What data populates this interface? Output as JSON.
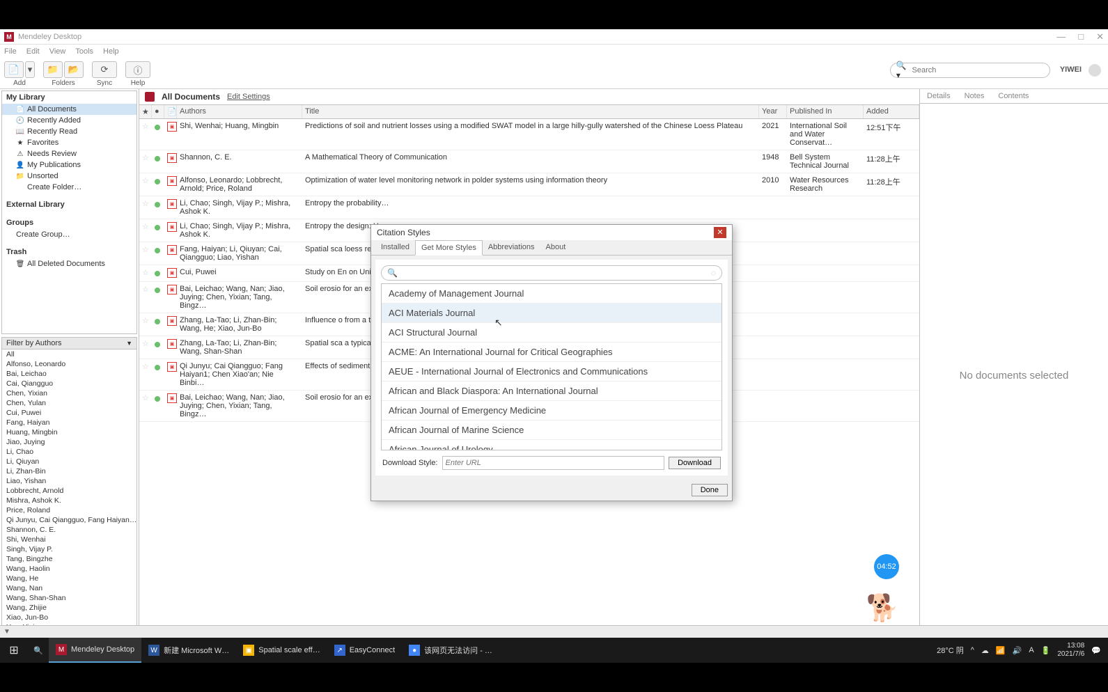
{
  "window": {
    "title": "Mendeley Desktop"
  },
  "menubar": [
    "File",
    "Edit",
    "View",
    "Tools",
    "Help"
  ],
  "toolbar": {
    "add": "Add",
    "folders": "Folders",
    "sync": "Sync",
    "help": "Help",
    "search_placeholder": "Search",
    "user": "YIWEI"
  },
  "library": {
    "my_library": "My Library",
    "items": [
      {
        "label": "All Documents",
        "sel": true,
        "ico": "📄"
      },
      {
        "label": "Recently Added",
        "ico": "🕘"
      },
      {
        "label": "Recently Read",
        "ico": "📖"
      },
      {
        "label": "Favorites",
        "ico": "★"
      },
      {
        "label": "Needs Review",
        "ico": "⚠"
      },
      {
        "label": "My Publications",
        "ico": "👤"
      },
      {
        "label": "Unsorted",
        "ico": "📁"
      },
      {
        "label": "Create Folder…",
        "ico": ""
      }
    ],
    "external": "External Library",
    "groups": "Groups",
    "create_group": "Create Group…",
    "trash": "Trash",
    "all_deleted": "All Deleted Documents"
  },
  "filter": {
    "title": "Filter by Authors",
    "items": [
      "All",
      "Alfonso, Leonardo",
      "Bai, Leichao",
      "Cai, Qiangguo",
      "Chen, Yixian",
      "Chen, Yulan",
      "Cui, Puwei",
      "Fang, Haiyan",
      "Huang, Mingbin",
      "Jiao, Juying",
      "Li, Chao",
      "Li, Qiuyan",
      "Li, Zhan-Bin",
      "Liao, Yishan",
      "Lobbrecht, Arnold",
      "Mishra, Ashok K.",
      "Price, Roland",
      "Qi Junyu, Cai Qiangguo, Fang Haiyan…",
      "Shannon, C. E.",
      "Shi, Wenhai",
      "Singh, Vijay P.",
      "Tang, Bingzhe",
      "Wang, Haolin",
      "Wang, He",
      "Wang, Nan",
      "Wang, Shan-Shan",
      "Wang, Zhijie",
      "Xiao, Jun-Bo",
      "Yan, Yiqin"
    ]
  },
  "doc_header": {
    "title": "All Documents",
    "edit": "Edit Settings"
  },
  "table": {
    "headers": {
      "authors": "Authors",
      "title": "Title",
      "year": "Year",
      "pub": "Published In",
      "added": "Added"
    },
    "rows": [
      {
        "authors": "Shi, Wenhai; Huang, Mingbin",
        "title": "Predictions of soil and nutrient losses using a modified SWAT model in a large hilly-gully watershed of the Chinese Loess Plateau",
        "year": "2021",
        "pub": "International Soil and Water Conservat…",
        "added": "12:51下午"
      },
      {
        "authors": "Shannon, C. E.",
        "title": "A Mathematical Theory of Communication",
        "year": "1948",
        "pub": "Bell System Technical Journal",
        "added": "11:28上午"
      },
      {
        "authors": "Alfonso, Leonardo; Lobbrecht, Arnold; Price, Roland",
        "title": "Optimization of water level monitoring network in polder systems using information theory",
        "year": "2010",
        "pub": "Water Resources Research",
        "added": "11:28上午"
      },
      {
        "authors": "Li, Chao; Singh, Vijay P.; Mishra, Ashok K.",
        "title": "Entropy the probability…",
        "year": "",
        "pub": "",
        "added": ""
      },
      {
        "authors": "Li, Chao; Singh, Vijay P.; Mishra, Ashok K.",
        "title": "Entropy the design: Han…",
        "year": "",
        "pub": "",
        "added": ""
      },
      {
        "authors": "Fang, Haiyan; Li, Qiuyan; Cai, Qiangguo; Liao, Yishan",
        "title": "Spatial sca loess regi…",
        "year": "",
        "pub": "",
        "added": ""
      },
      {
        "authors": "Cui, Puwei",
        "title": "Study on En on Unit-Wat…",
        "year": "",
        "pub": "",
        "added": ""
      },
      {
        "authors": "Bai, Leichao; Wang, Nan; Jiao, Juying; Chen, Yixian; Tang, Bingz…",
        "title": "Soil erosio for an extr…",
        "year": "",
        "pub": "",
        "added": ""
      },
      {
        "authors": "Zhang, La-Tao; Li, Zhan-Bin; Wang, He; Xiao, Jun-Bo",
        "title": "Influence o from a typi…",
        "year": "",
        "pub": "",
        "added": ""
      },
      {
        "authors": "Zhang, La-Tao; Li, Zhan-Bin; Wang, Shan-Shan",
        "title": "Spatial sca a typical a…",
        "year": "",
        "pub": "",
        "added": ""
      },
      {
        "authors": "Qi Junyu; Cai Qiangguo; Fang Haiyan1; Chen Xiao'an; Nie Binbi…",
        "title": "Effects of sediment in…",
        "year": "",
        "pub": "",
        "added": ""
      },
      {
        "authors": "Bai, Leichao; Wang, Nan; Jiao, Juying; Chen, Yixian; Tang, Bingz…",
        "title": "Soil erosio for an extr…",
        "year": "",
        "pub": "",
        "added": ""
      }
    ]
  },
  "right_panel": {
    "tabs": [
      "Details",
      "Notes",
      "Contents"
    ],
    "empty": "No documents selected"
  },
  "dialog": {
    "title": "Citation Styles",
    "tabs": [
      "Installed",
      "Get More Styles",
      "Abbreviations",
      "About"
    ],
    "active_tab": 1,
    "styles": [
      "Academy of Management Journal",
      "ACI Materials Journal",
      "ACI Structural Journal",
      "ACME: An International Journal for Critical Geographies",
      "AEUE - International Journal of Electronics and Communications",
      "African and Black Diaspora: An International Journal",
      "African Journal of Emergency Medicine",
      "African Journal of Marine Science",
      "African Journal of Urology"
    ],
    "download_label": "Download Style:",
    "download_placeholder": "Enter URL",
    "download_btn": "Download",
    "done": "Done"
  },
  "bubble": "04:52",
  "taskbar": {
    "items": [
      {
        "label": "Mendeley Desktop",
        "active": true,
        "color": "#a6192e",
        "txt": "M"
      },
      {
        "label": "新建 Microsoft W…",
        "color": "#2b579a",
        "txt": "W"
      },
      {
        "label": "Spatial scale eff…",
        "color": "#f4b400",
        "txt": "▣"
      },
      {
        "label": "EasyConnect",
        "color": "#3366cc",
        "txt": "↗"
      },
      {
        "label": "该网页无法访问 - …",
        "color": "#4285f4",
        "txt": "●"
      }
    ],
    "weather": "28°C 阴",
    "time": "13:08",
    "date": "2021/7/6"
  }
}
